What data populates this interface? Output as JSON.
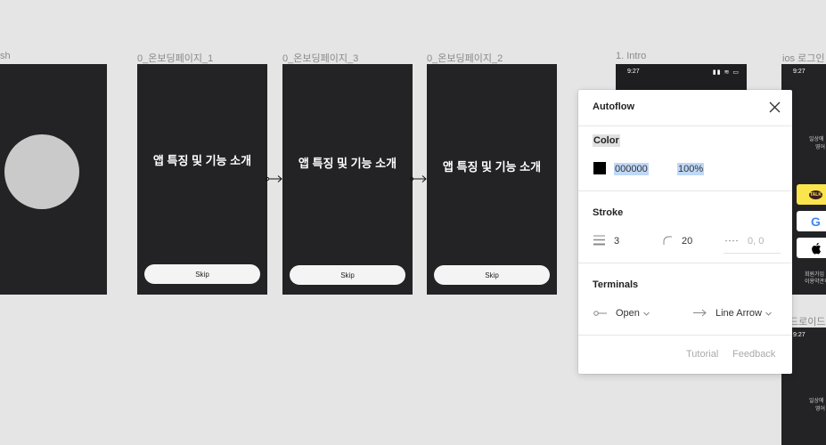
{
  "canvas": {
    "frames": [
      {
        "label": "sh"
      },
      {
        "label": "0_온보딩페이지_1",
        "title": "앱 특징 및 기능 소개",
        "skip": "Skip"
      },
      {
        "label": "0_온보딩페이지_3",
        "title": "앱 특징 및 기능 소개",
        "skip": "Skip"
      },
      {
        "label": "0_온보딩페이지_2",
        "title": "앱 특징 및 기능 소개",
        "skip": "Skip"
      },
      {
        "label": "1. Intro",
        "time": "9:27"
      },
      {
        "label": "ios 로그인",
        "time": "9:27",
        "snippet_top": "일상에",
        "snippet_top2": "영어",
        "kakao_label": "TALK",
        "snippet_bottom": "회원가입 시",
        "snippet_bottom2": "이용약관의"
      },
      {
        "label": "드로이드",
        "time": "9:27",
        "snippet_top": "일상에",
        "snippet_top2": "영어"
      }
    ]
  },
  "panel": {
    "title": "Autoflow",
    "color": {
      "section_label": "Color",
      "hex": "000000",
      "opacity": "100%",
      "swatch_color": "#000000"
    },
    "stroke": {
      "section_label": "Stroke",
      "weight": "3",
      "radius": "20",
      "dash": "0, 0"
    },
    "terminals": {
      "section_label": "Terminals",
      "start": "Open",
      "end": "Line Arrow"
    },
    "footer": {
      "tutorial": "Tutorial",
      "feedback": "Feedback"
    }
  }
}
